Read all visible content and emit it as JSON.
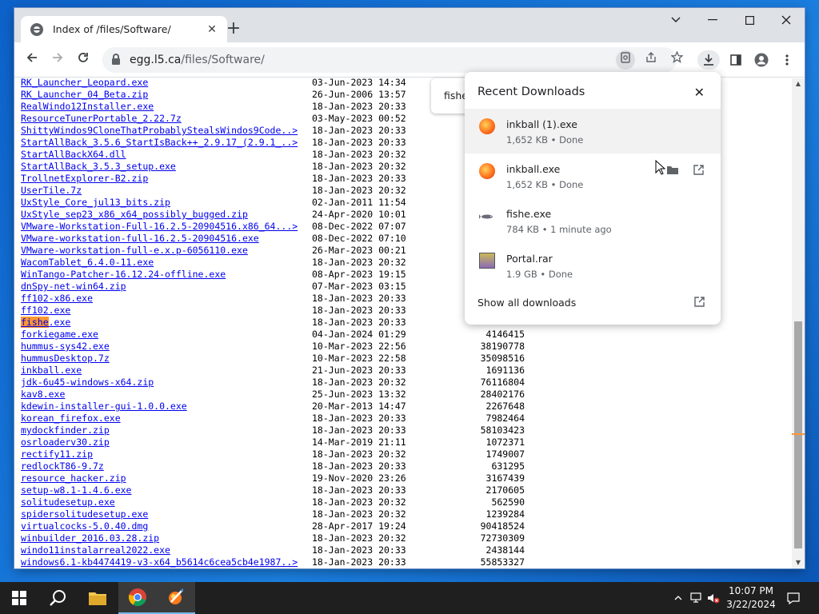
{
  "browser": {
    "tab_title": "Index of /files/Software/",
    "tab_close": "✕",
    "new_tab": "+",
    "url_host": "egg.l5.ca",
    "url_path": "/files/Software/"
  },
  "find_bar": {
    "query": "fishe"
  },
  "listing": [
    {
      "name": "RK_Launcher_Leopard.exe",
      "date": "03-Jun-2023 14:34",
      "size": ""
    },
    {
      "name": "RK_Launcher_04_Beta.zip",
      "date": "26-Jun-2006 13:57",
      "size": ""
    },
    {
      "name": "RealWindo12Installer.exe",
      "date": "18-Jan-2023 20:33",
      "size": ""
    },
    {
      "name": "ResourceTunerPortable_2.22.7z",
      "date": "03-May-2023 00:52",
      "size": ""
    },
    {
      "name": "ShittyWindos9CloneThatProbablyStealsWindos9Code..>",
      "date": "18-Jan-2023 20:33",
      "size": ""
    },
    {
      "name": "StartAllBack_3.5.6_StartIsBack++_2.9.17_(2.9.1_..>",
      "date": "18-Jan-2023 20:33",
      "size": ""
    },
    {
      "name": "StartAllBackX64.dll",
      "date": "18-Jan-2023 20:32",
      "size": ""
    },
    {
      "name": "StartAllBack_3.5.3_setup.exe",
      "date": "18-Jan-2023 20:32",
      "size": ""
    },
    {
      "name": "TrollnetExplorer-B2.zip",
      "date": "18-Jan-2023 20:33",
      "size": ""
    },
    {
      "name": "UserTile.7z",
      "date": "18-Jan-2023 20:32",
      "size": ""
    },
    {
      "name": "UxStyle_Core_jul13_bits.zip",
      "date": "02-Jan-2011 11:54",
      "size": ""
    },
    {
      "name": "UxStyle_sep23_x86_x64_possibly_bugged.zip",
      "date": "24-Apr-2020 10:01",
      "size": ""
    },
    {
      "name": "VMware-Workstation-Full-16.2.5-20904516.x86_64...>",
      "date": "08-Dec-2022 07:07",
      "size": ""
    },
    {
      "name": "VMware-workstation-full-16.2.5-20904516.exe",
      "date": "08-Dec-2022 07:10",
      "size": ""
    },
    {
      "name": "VMware-workstation-full-e.x.p-6056110.exe",
      "date": "26-Mar-2023 00:21",
      "size": ""
    },
    {
      "name": "WacomTablet_6.4.0-11.exe",
      "date": "18-Jan-2023 20:32",
      "size": ""
    },
    {
      "name": "WinTango-Patcher-16.12.24-offline.exe",
      "date": "08-Apr-2023 19:15",
      "size": ""
    },
    {
      "name": "dnSpy-net-win64.zip",
      "date": "07-Mar-2023 03:15",
      "size": ""
    },
    {
      "name": "ff102-x86.exe",
      "date": "18-Jan-2023 20:33",
      "size": ""
    },
    {
      "name": "ff102.exe",
      "date": "18-Jan-2023 20:33",
      "size": ""
    },
    {
      "name": ".exe",
      "prefix": "fishe",
      "date": "18-Jan-2023 20:33",
      "size": ""
    },
    {
      "name": "forkiegame.exe",
      "date": "04-Jan-2024 01:29",
      "size": "4146415"
    },
    {
      "name": "hummus-sys42.exe",
      "date": "10-Mar-2023 22:56",
      "size": "38190778"
    },
    {
      "name": "hummusDesktop.7z",
      "date": "10-Mar-2023 22:58",
      "size": "35098516"
    },
    {
      "name": "inkball.exe",
      "date": "21-Jun-2023 20:33",
      "size": "1691136"
    },
    {
      "name": "jdk-6u45-windows-x64.zip",
      "date": "18-Jan-2023 20:32",
      "size": "76116804"
    },
    {
      "name": "kav8.exe",
      "date": "25-Jun-2023 13:32",
      "size": "28402176"
    },
    {
      "name": "kdewin-installer-gui-1.0.0.exe",
      "date": "20-Mar-2013 14:47",
      "size": "2267648"
    },
    {
      "name": "korean_firefox.exe",
      "date": "18-Jan-2023 20:33",
      "size": "7982464"
    },
    {
      "name": "mydockfinder.zip",
      "date": "18-Jan-2023 20:33",
      "size": "58103423"
    },
    {
      "name": "osrloaderv30.zip",
      "date": "14-Mar-2019 21:11",
      "size": "1072371"
    },
    {
      "name": "rectify11.zip",
      "date": "18-Jan-2023 20:32",
      "size": "1749007"
    },
    {
      "name": "redlockT86-9.7z",
      "date": "18-Jan-2023 20:33",
      "size": "631295"
    },
    {
      "name": "resource_hacker.zip",
      "date": "19-Nov-2020 23:26",
      "size": "3167439"
    },
    {
      "name": "setup-w8.1-1.4.6.exe",
      "date": "18-Jan-2023 20:33",
      "size": "2170605"
    },
    {
      "name": "solitudesetup.exe",
      "date": "18-Jan-2023 20:32",
      "size": "562590"
    },
    {
      "name": "spidersolitudesetup.exe",
      "date": "18-Jan-2023 20:32",
      "size": "1239284"
    },
    {
      "name": "virtualcocks-5.0.40.dmg",
      "date": "28-Apr-2017 19:24",
      "size": "90418524"
    },
    {
      "name": "winbuilder_2016.03.28.zip",
      "date": "18-Jan-2023 20:32",
      "size": "72730309"
    },
    {
      "name": "windo11instalarreal2022.exe",
      "date": "18-Jan-2023 20:33",
      "size": "2438144"
    },
    {
      "name": "windows6.1-kb4474419-v3-x64_b5614c6cea5cb4e1987..>",
      "date": "18-Jan-2023 20:33",
      "size": "55853327"
    }
  ],
  "downloads": {
    "title": "Recent Downloads",
    "close": "✕",
    "items": [
      {
        "name": "inkball (1).exe",
        "meta": "1,652 KB • Done",
        "icon": "inkball-icon"
      },
      {
        "name": "inkball.exe",
        "meta": "1,652 KB • Done",
        "icon": "inkball-icon"
      },
      {
        "name": "fishe.exe",
        "meta": "784 KB • 1 minute ago",
        "icon": "fish-icon"
      },
      {
        "name": "Portal.rar",
        "meta": "1.9 GB • Done",
        "icon": "rar-archive-icon"
      }
    ],
    "show_all": "Show all downloads"
  },
  "taskbar": {
    "time": "10:07 PM",
    "date": "3/22/2024"
  }
}
